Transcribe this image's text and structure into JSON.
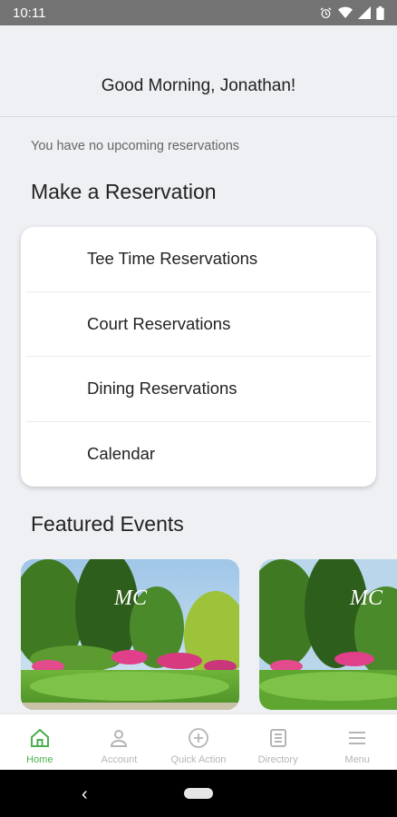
{
  "status_bar": {
    "time": "10:11",
    "icons": [
      "alarm-icon",
      "wifi-icon",
      "signal-icon",
      "battery-icon"
    ]
  },
  "greeting": "Good Morning, Jonathan!",
  "reservations_status": "You have no upcoming reservations",
  "make_reservation": {
    "title": "Make a Reservation",
    "items": [
      {
        "label": "Tee Time Reservations"
      },
      {
        "label": "Court Reservations"
      },
      {
        "label": "Dining Reservations"
      },
      {
        "label": "Calendar"
      }
    ]
  },
  "featured_events": {
    "title": "Featured Events"
  },
  "bottom_nav": {
    "items": [
      {
        "label": "Home",
        "icon": "home-icon",
        "active": true
      },
      {
        "label": "Account",
        "icon": "account-icon",
        "active": false
      },
      {
        "label": "Quick Action",
        "icon": "plus-circle-icon",
        "active": false
      },
      {
        "label": "Directory",
        "icon": "directory-icon",
        "active": false
      },
      {
        "label": "Menu",
        "icon": "menu-icon",
        "active": false
      }
    ]
  },
  "colors": {
    "accent": "#4caf50",
    "background": "#eff0f4",
    "inactive": "#b5b5b5"
  }
}
